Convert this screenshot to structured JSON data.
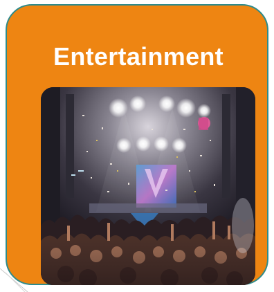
{
  "card": {
    "title": "Entertainment",
    "background_color": "#ee8512",
    "border_color": "#2e8b8b"
  },
  "photo": {
    "subject": "concert-crowd-with-confetti",
    "icon": "concert-photo"
  }
}
